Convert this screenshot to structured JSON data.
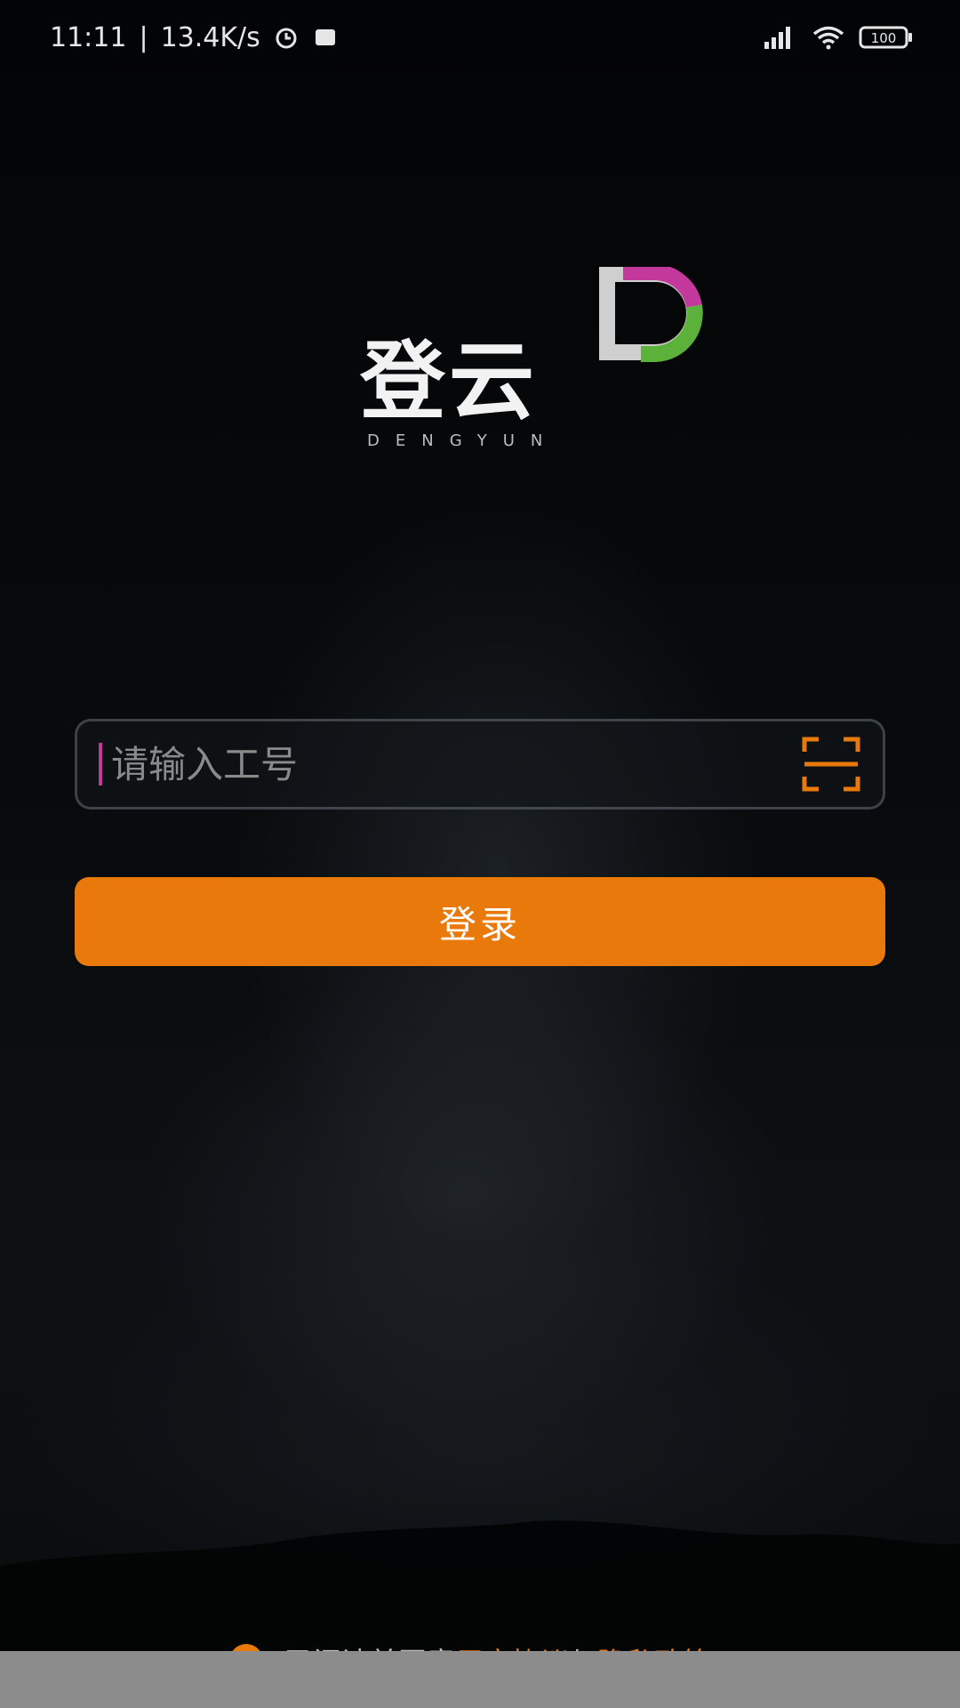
{
  "status_bar": {
    "time": "11:11",
    "separator": "|",
    "speed": "13.4K/s",
    "battery": "100"
  },
  "logo": {
    "title": "登云",
    "subtitle": "DENGYUN",
    "colors": {
      "magenta": "#c2399b",
      "green": "#5bb13a",
      "silver": "#cfcfcf"
    }
  },
  "login": {
    "input_placeholder": "请输入工号",
    "input_value": "",
    "scan_icon": "scan-icon",
    "button_label": "登录"
  },
  "agreement": {
    "prefix": "已阅读并同意",
    "user_agreement": "用户协议",
    "connector": "与",
    "privacy_policy": "隐私政策"
  },
  "colors": {
    "accent": "#e8790a",
    "background": "#050607"
  }
}
